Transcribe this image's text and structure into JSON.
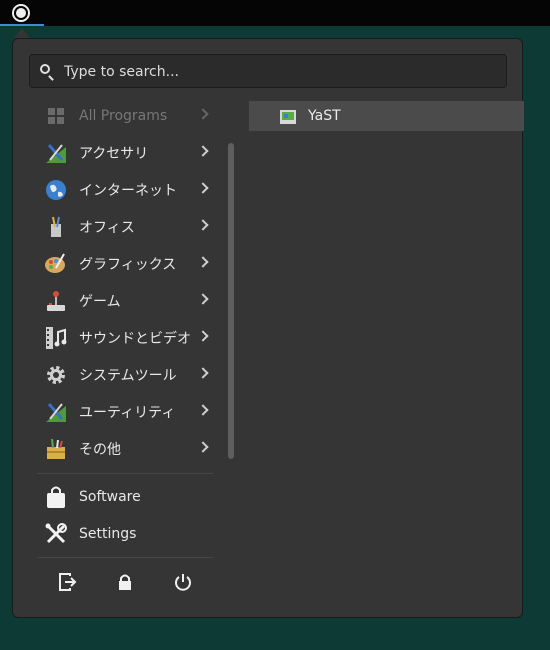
{
  "search": {
    "placeholder": "Type to search..."
  },
  "categories": [
    {
      "label": "All Programs",
      "icon": "grid-icon",
      "dim": true
    },
    {
      "label": "アクセサリ",
      "icon": "accessories-icon"
    },
    {
      "label": "インターネット",
      "icon": "globe-icon"
    },
    {
      "label": "オフィス",
      "icon": "office-icon"
    },
    {
      "label": "グラフィックス",
      "icon": "palette-icon"
    },
    {
      "label": "ゲーム",
      "icon": "joystick-icon"
    },
    {
      "label": "サウンドとビデオ",
      "icon": "film-music-icon"
    },
    {
      "label": "システムツール",
      "icon": "gear-icon"
    },
    {
      "label": "ユーティリティ",
      "icon": "utilities-icon"
    },
    {
      "label": "その他",
      "icon": "other-icon"
    }
  ],
  "favorites": [
    {
      "label": "Software",
      "icon": "shopping-bag-icon"
    },
    {
      "label": "Settings",
      "icon": "tools-icon"
    }
  ],
  "system_buttons": [
    {
      "name": "logout-icon"
    },
    {
      "name": "lock-icon"
    },
    {
      "name": "power-icon"
    }
  ],
  "apps": [
    {
      "label": "YaST",
      "icon": "yast-icon",
      "selected": true
    }
  ],
  "colors": {
    "panel": "#353535",
    "desktop": "#0e3a36",
    "accent": "#3e8ad8",
    "selection": "#4b4b4b"
  }
}
